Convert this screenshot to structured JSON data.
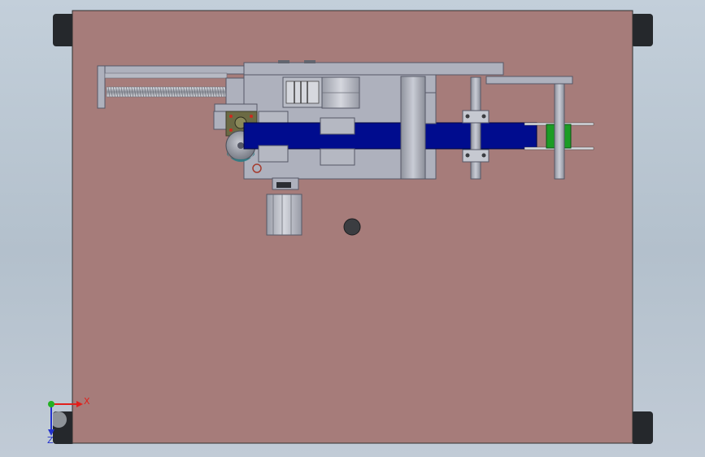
{
  "app": {
    "type": "CAD assembly viewport"
  },
  "scene": {
    "background_top": "#c3cfda",
    "background_bottom": "#b7c3cf",
    "plate_color": "#a67c7a",
    "metal_color": "#aeb1bd",
    "metal_dark": "#555866",
    "belt_color": "#000c8e",
    "roller_color": "#1c9c25",
    "foot_color": "#25282c",
    "hole_color": "#3b3d41"
  },
  "triad": {
    "x_label": "X",
    "y_label": "Y",
    "z_label": "Z",
    "x_color": "#e0201c",
    "y_color": "#22b022",
    "z_color": "#2433cc"
  }
}
